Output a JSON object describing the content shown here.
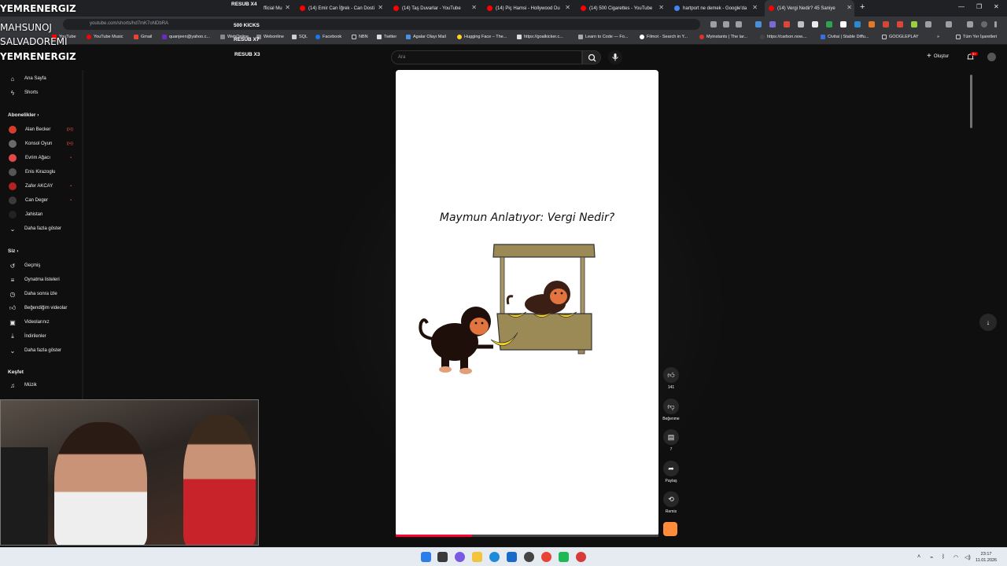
{
  "browser": {
    "tabs": [
      {
        "title": "fficial Mu",
        "fav": "#ff0000"
      },
      {
        "title": "(14) Emir Can İğrek - Can Dosti",
        "fav": "#ff0000"
      },
      {
        "title": "(14) Taş Duvarlar - YouTube",
        "fav": "#ff0000"
      },
      {
        "title": "(14) Piç Hamsi - Hollywood Du",
        "fav": "#ff0000"
      },
      {
        "title": "(14) 500 Cigarettes - YouTube",
        "fav": "#ff0000"
      },
      {
        "title": "hartport ne demek - Google'da",
        "fav": "#4285f4"
      },
      {
        "title": "(14) Vergi Nedir? 45 Saniye",
        "fav": "#ff0000"
      }
    ],
    "url": "youtube.com/shorts/hd7mK7oNDbRA",
    "bookmarks": [
      "YouTube",
      "YouTube Music",
      "Gmail",
      "quanjeen@yahoo.c...",
      "WebOnline",
      "Webonline",
      "SQL",
      "Facebook",
      "NBN",
      "Twitter",
      "Agalar Olayı Mail",
      "Hugging Face – The...",
      "https://goalkicker.c...",
      "Learn to Code — Fo...",
      "Filmot - Search in Y...",
      "Myinstants | The lar...",
      "https://carbon.now....",
      "Civitai | Stable Diffu...",
      "GOOGLEPLAY"
    ],
    "all_bookmarks": "Tüm Yer İşaretleri"
  },
  "youtube": {
    "search_placeholder": "Ara",
    "create_label": "Oluştur",
    "notif_count": "9+",
    "sidebar": {
      "main": [
        {
          "label": "Ana Sayfa",
          "icon": "home-icon"
        },
        {
          "label": "Shorts",
          "icon": "shorts-icon"
        }
      ],
      "subs_header": "Abonelikler",
      "subs": [
        {
          "label": "Alan Becker",
          "color": "#d43c2c",
          "live": true
        },
        {
          "label": "Konsol Oyun",
          "color": "#6a6a6a",
          "live": true
        },
        {
          "label": "Evrim Ağacı",
          "color": "#e04a4a",
          "live": false
        },
        {
          "label": "Enis Kirazoglu",
          "color": "#555555",
          "live": false
        },
        {
          "label": "Zafer AKCAY",
          "color": "#b22222",
          "live": false
        },
        {
          "label": "Can Deger",
          "color": "#3a3a3a",
          "live": false
        },
        {
          "label": "Jahistan",
          "color": "#222222",
          "live": false
        }
      ],
      "subs_more": "Daha fazla göster",
      "you_header": "Siz",
      "you": [
        {
          "label": "Geçmiş",
          "icon": "history-icon"
        },
        {
          "label": "Oynatma listeleri",
          "icon": "playlist-icon"
        },
        {
          "label": "Daha sonra izle",
          "icon": "watch-later-icon"
        },
        {
          "label": "Beğendiğim videolar",
          "icon": "like-icon"
        },
        {
          "label": "Videolarınız",
          "icon": "your-videos-icon"
        },
        {
          "label": "İndirilenler",
          "icon": "download-icon"
        }
      ],
      "you_more": "Daha fazla göster",
      "explore_header": "Keşfet",
      "explore": [
        {
          "label": "Müzik",
          "icon": "music-icon"
        }
      ]
    },
    "short": {
      "title": "Maymun Anlatıyor: Vergi Nedir?",
      "progress": 0.29
    },
    "actions": {
      "likes": "141",
      "dislike": "Beğenme",
      "comments": "7",
      "share": "Paylaş",
      "remix": "Remix"
    }
  },
  "overlay": {
    "left_lines": [
      "YEMRENERGIZ",
      "MAHSUNOJ",
      "SALVADOREMI",
      "YEMRENERGIZ"
    ],
    "right_lines": [
      "RESUB X4",
      "500 KICKS",
      "RESUB X7",
      "RESUB X3"
    ]
  },
  "taskbar": {
    "time": "23:17",
    "date": "11.01.2026"
  }
}
